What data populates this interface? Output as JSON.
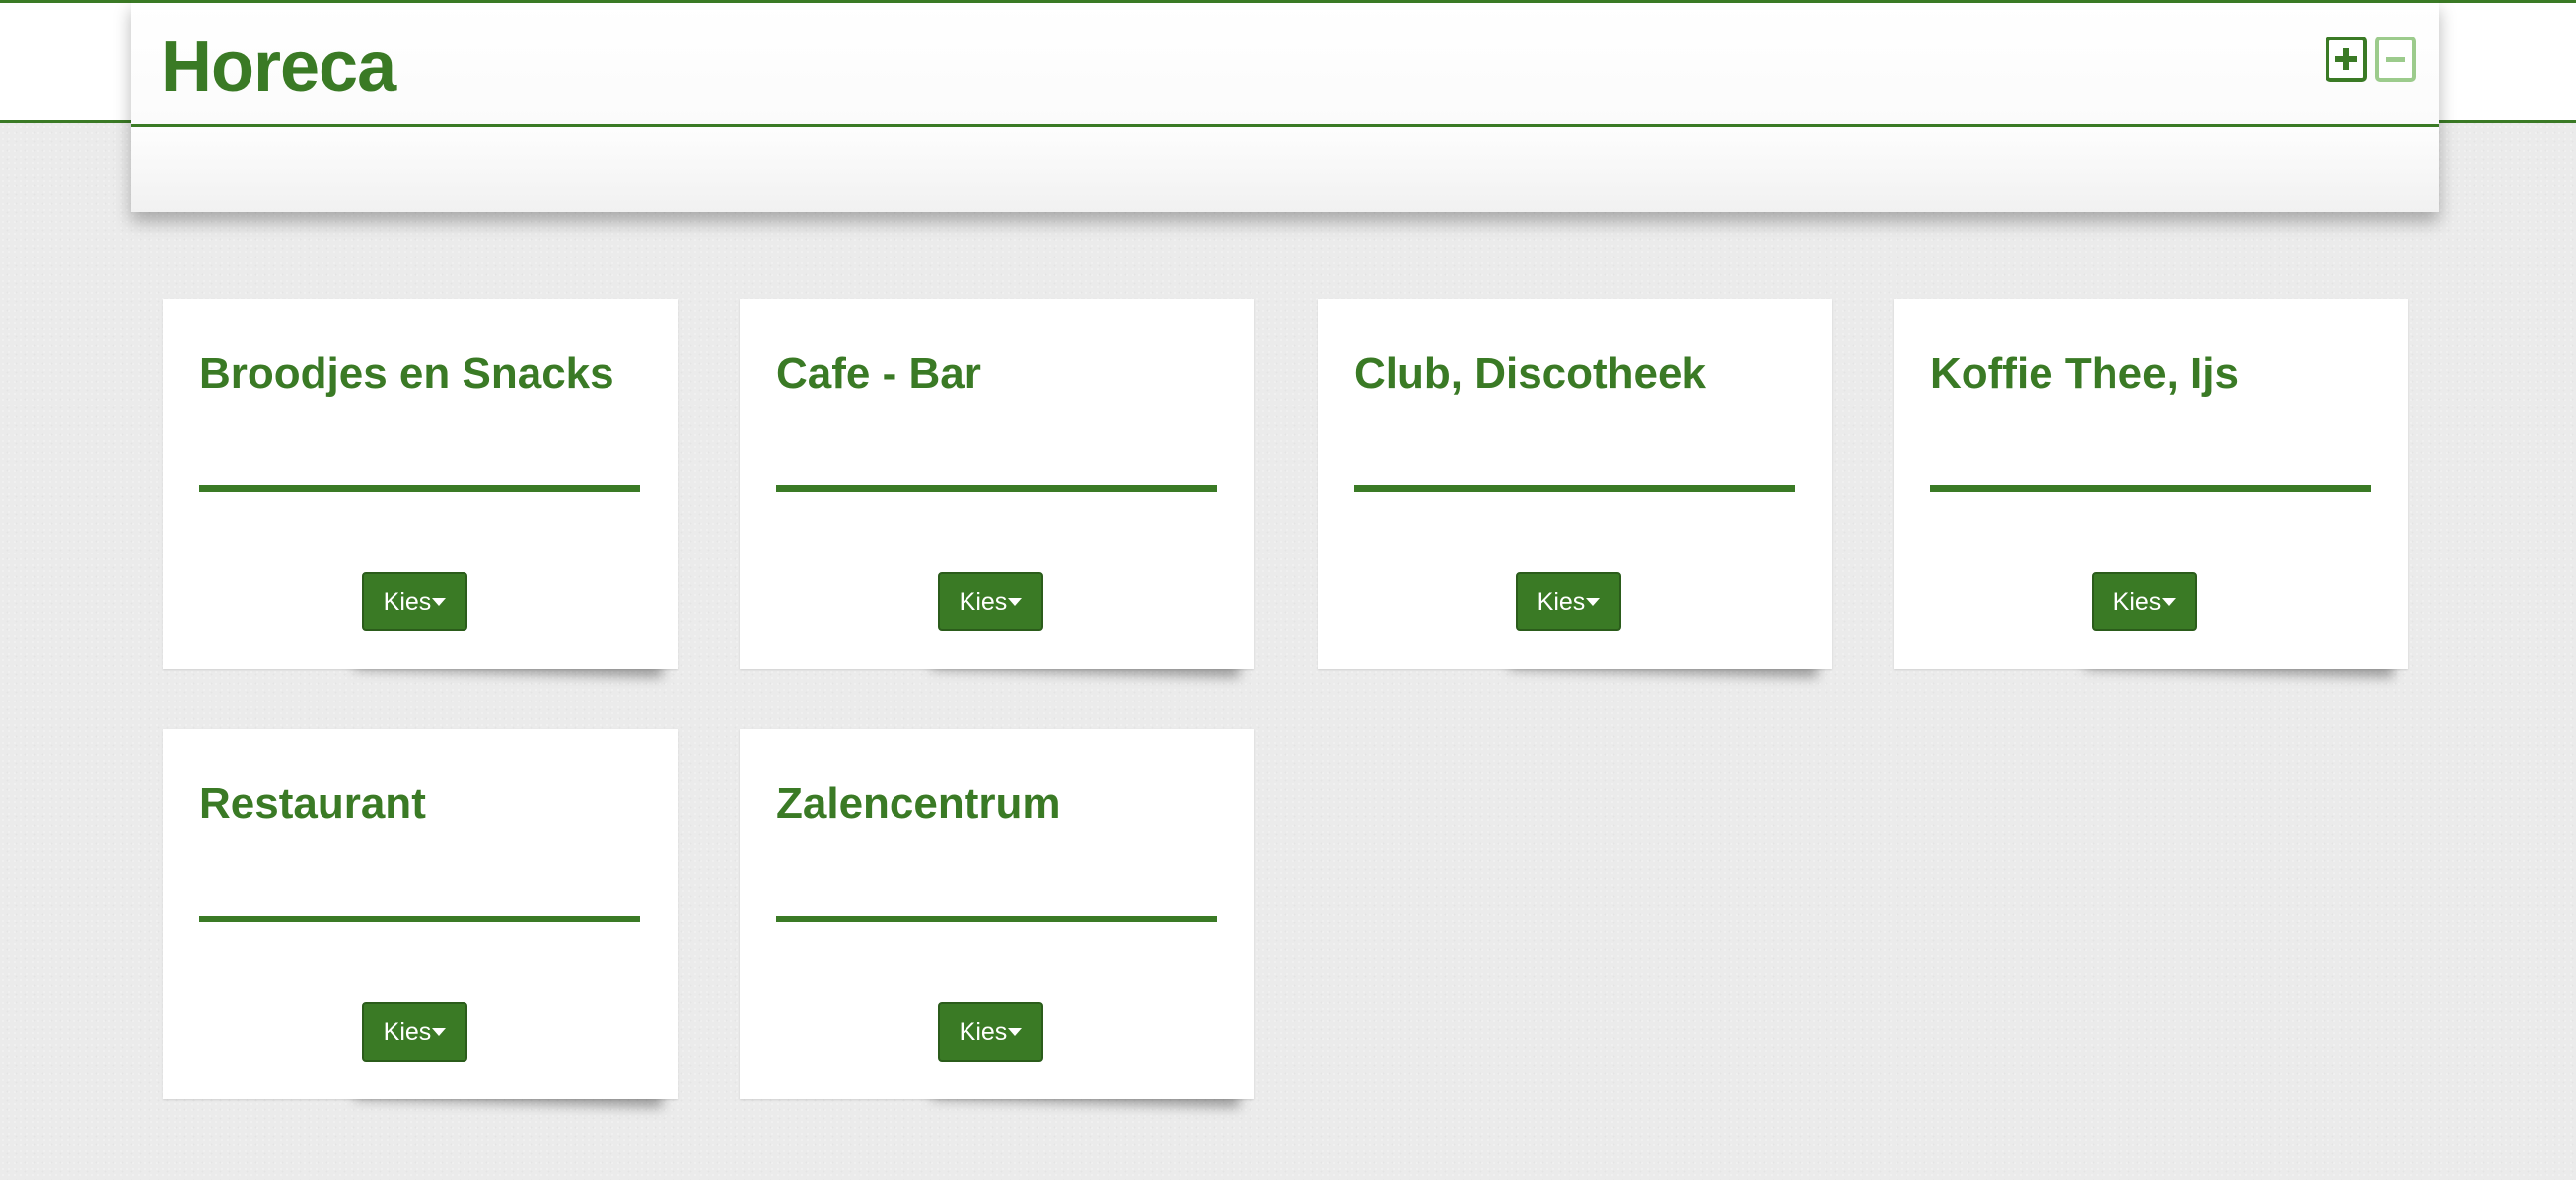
{
  "header": {
    "title": "Horeca",
    "zoom_in_icon": "plus-icon",
    "zoom_out_icon": "minus-icon"
  },
  "categories": [
    {
      "title": "Broodjes en Snacks",
      "button_label": "Kies"
    },
    {
      "title": "Cafe - Bar",
      "button_label": "Kies"
    },
    {
      "title": "Club, Discotheek",
      "button_label": "Kies"
    },
    {
      "title": "Koffie Thee, Ijs",
      "button_label": "Kies"
    },
    {
      "title": "Restaurant",
      "button_label": "Kies"
    },
    {
      "title": "Zalencentrum",
      "button_label": "Kies"
    }
  ],
  "colors": {
    "accent": "#3a7a25",
    "accent_light": "#9ccb8c",
    "background": "#ebebeb",
    "card": "#ffffff"
  },
  "icons": {
    "dropdown": "caret-down-icon"
  }
}
